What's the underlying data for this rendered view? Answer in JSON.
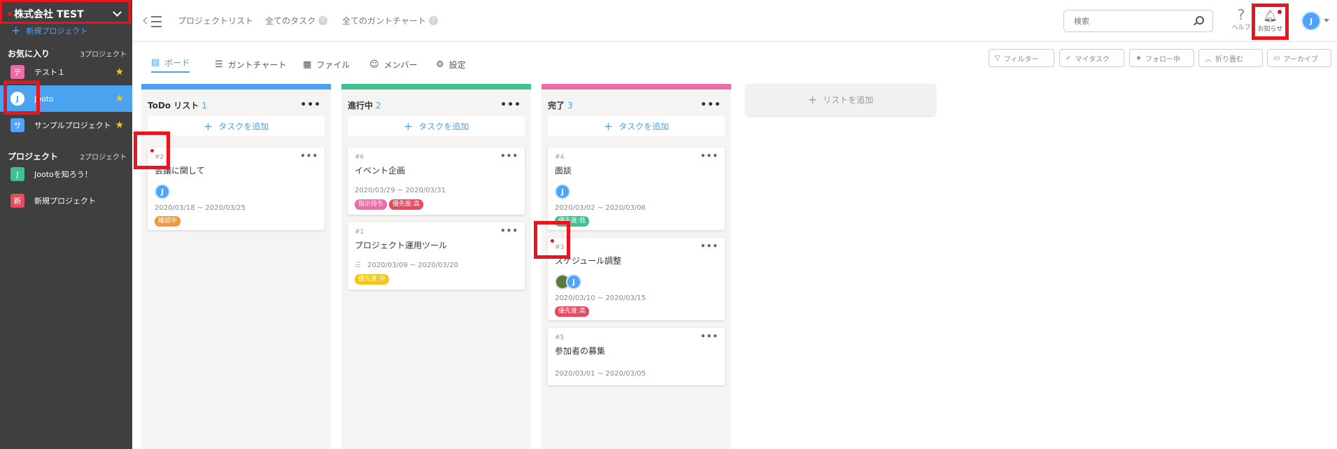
{
  "sidebar": {
    "company": "株式会社 TEST",
    "new_project": "新規プロジェクト",
    "favorites": {
      "heading": "お気に入り",
      "count": "3プロジェクト",
      "items": [
        {
          "icon_char": "テ",
          "label": "テスト１",
          "color": "#f06aa8"
        },
        {
          "icon_char": "J",
          "label": "Jooto",
          "color": "#4da3ff"
        },
        {
          "icon_char": "サ",
          "label": "サンプルプロジェクト",
          "color": "#4da3ff"
        }
      ]
    },
    "projects": {
      "heading": "プロジェクト",
      "count": "2プロジェクト",
      "items": [
        {
          "icon_char": "J",
          "label": "Jootoを知ろう！",
          "color": "#3cc38f"
        },
        {
          "icon_char": "新",
          "label": "新規プロジェクト",
          "color": "#e84a5f"
        }
      ]
    }
  },
  "topbar": {
    "nav": [
      "プロジェクトリスト",
      "全てのタスク",
      "全てのガントチャート"
    ],
    "search_placeholder": "検索",
    "help": "ヘルプ",
    "notifications": "お知らせ"
  },
  "tabs": [
    "ボード",
    "ガントチャート",
    "ファイル",
    "メンバー",
    "設定"
  ],
  "filters": [
    "フィルター",
    "マイタスク",
    "フォロー中",
    "折り畳む",
    "アーカイブ"
  ],
  "board": {
    "add_task": "タスクを追加",
    "add_list": "リストを追加",
    "columns": [
      {
        "title": "ToDo リスト",
        "count": "1",
        "color": "#4aa3f0",
        "cards": [
          {
            "num": "#2",
            "title": "会議に関して",
            "date": "2020/03/18 ~ 2020/03/25",
            "tags": [
              {
                "text": "確認中",
                "color": "#f39a3c"
              }
            ]
          }
        ]
      },
      {
        "title": "進行中",
        "count": "2",
        "color": "#3cc38f",
        "cards": [
          {
            "num": "#6",
            "title": "イベント企画",
            "date": "2020/03/29 ~ 2020/03/31",
            "tags": [
              {
                "text": "指示待ち",
                "color": "#f06aa8"
              },
              {
                "text": "優先度:高",
                "color": "#e84a5f"
              }
            ]
          },
          {
            "num": "#1",
            "title": "プロジェクト運用ツール",
            "date": "2020/03/09 ~ 2020/03/20",
            "tags": [
              {
                "text": "優先度:中",
                "color": "#f5c518"
              }
            ]
          }
        ]
      },
      {
        "title": "完了",
        "count": "3",
        "color": "#f06aa8",
        "cards": [
          {
            "num": "#4",
            "title": "面談",
            "date": "2020/03/02 ~ 2020/03/06",
            "tags": [
              {
                "text": "優先度:低",
                "color": "#3cc38f"
              }
            ]
          },
          {
            "num": "#3",
            "title": "スケジュール調整",
            "date": "2020/03/10 ~ 2020/03/15",
            "tags": [
              {
                "text": "優先度:高",
                "color": "#e84a5f"
              }
            ]
          },
          {
            "num": "#5",
            "title": "参加者の募集",
            "date": "2020/03/01 ~ 2020/03/05",
            "tags": []
          }
        ]
      }
    ]
  }
}
